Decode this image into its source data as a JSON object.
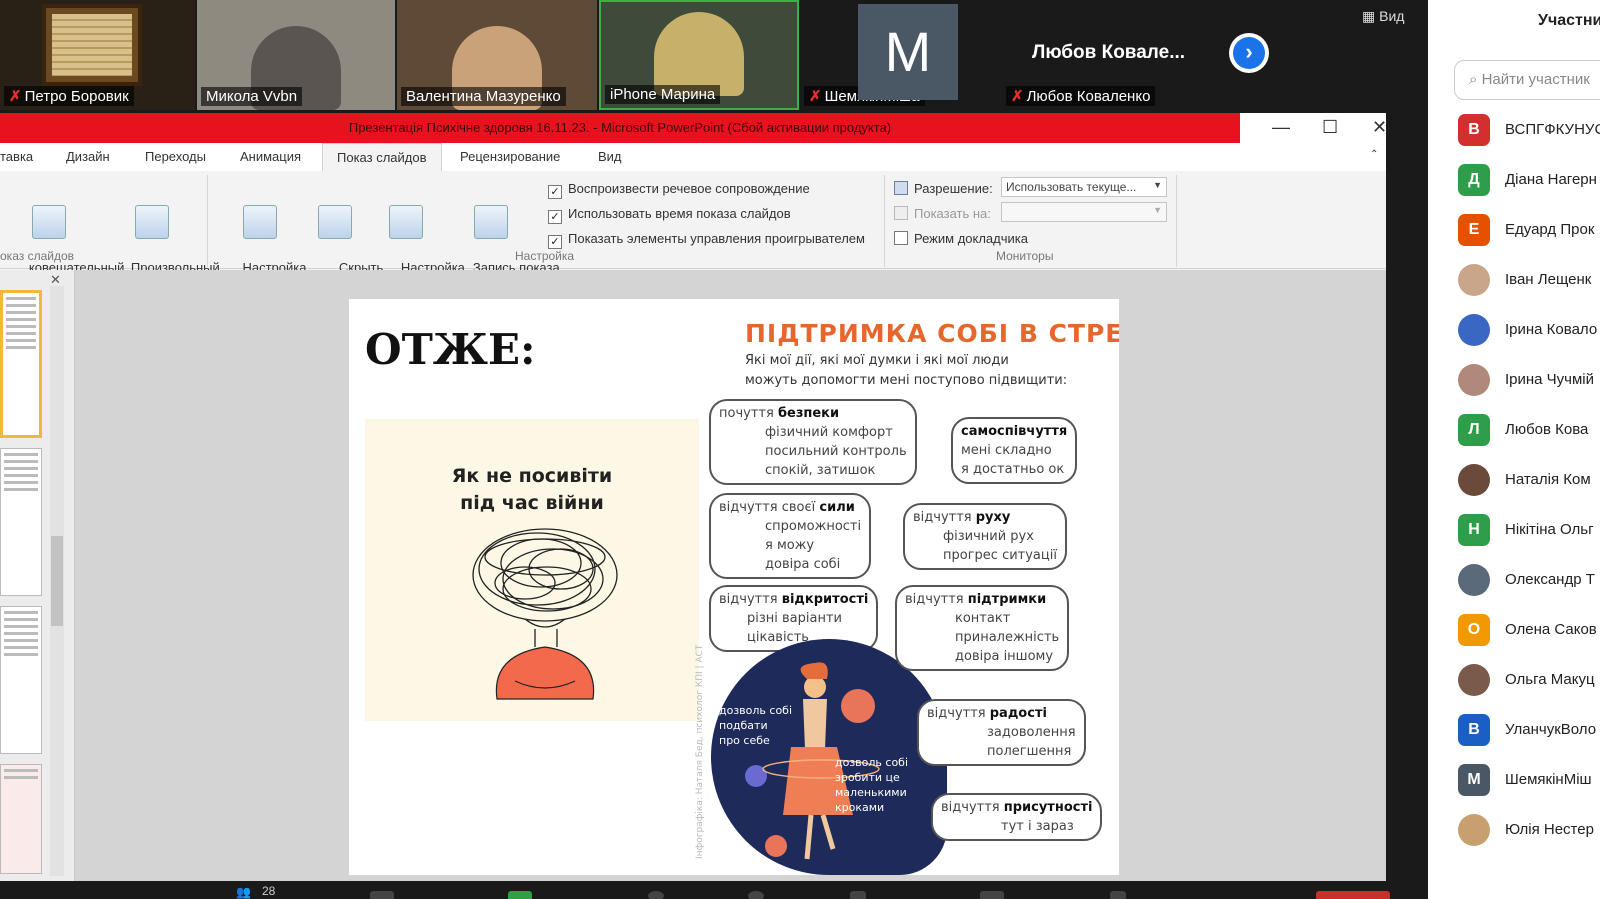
{
  "video_strip": {
    "tiles": [
      {
        "name": "Петро Боровик",
        "muted": true
      },
      {
        "name": "Микола Vvbn",
        "muted": false
      },
      {
        "name": "Валентина Мазуренко",
        "muted": false
      },
      {
        "name": "iPhone Марина",
        "muted": false
      },
      {
        "name": "ШемякінМіша",
        "muted": true,
        "avatar_letter": "M"
      },
      {
        "name": "Любов Коваленко",
        "muted": true,
        "big_name": "Любов Ковале..."
      }
    ],
    "view_label": "Вид",
    "next_icon": "chevron-right-icon"
  },
  "powerpoint": {
    "title": "Презентація Психічне здоровя 16.11.23. - Microsoft PowerPoint (Сбой активации продукта)",
    "title_color": "#e8111e",
    "tabs": [
      "тавка",
      "Дизайн",
      "Переходы",
      "Анимация",
      "Показ слайдов",
      "Рецензирование",
      "Вид"
    ],
    "active_tab": "Показ слайдов",
    "ribbon": {
      "btn_presenter": "ковещательный\nоказ слайдов",
      "btn_custom": "Произвольный\nпоказ ▾",
      "group_show": "оказ слайдов",
      "btn_setup": "Настройка\nдемонстрации",
      "btn_hide": "Скрыть\nслайд",
      "btn_timing": "Настройка\nвремени",
      "btn_record": "Запись показа\nслайдов ▾",
      "chk_narration": "Воспроизвести речевое сопровождение",
      "chk_timings": "Использовать время показа слайдов",
      "chk_controls": "Показать элементы управления проигрывателем",
      "group_setup": "Настройка",
      "resolution_label": "Разрешение:",
      "resolution_value": "Использовать текуще...",
      "show_on_label": "Показать на:",
      "presenter_mode": "Режим докладчика",
      "group_monitors": "Мониторы"
    }
  },
  "slide": {
    "title": "ОТЖЕ:",
    "book_title": "Як не посивіти\nпід час війни",
    "right_heading": "ПІДТРИМКА СОБІ В СТРЕСІ",
    "subtitle_line1": "Які мої дії, які мої думки і які мої люди",
    "subtitle_line2": "можуть допомогти мені поступово підвищити:",
    "clouds": [
      {
        "lead": "почуття ",
        "bold": "безпеки",
        "lines": [
          "фізичний комфорт",
          "посильний контроль",
          "спокій, затишок"
        ]
      },
      {
        "lead": "",
        "bold": "самоспівчуття",
        "lines": [
          "мені складно",
          "я достатньо ок"
        ]
      },
      {
        "lead": "відчуття своєї ",
        "bold": "сили",
        "lines": [
          "спроможності",
          "я можу",
          "довіра собі"
        ]
      },
      {
        "lead": "відчуття ",
        "bold": "руху",
        "lines": [
          "фізичний рух",
          "прогрес ситуації"
        ]
      },
      {
        "lead": "відчуття ",
        "bold": "відкритості",
        "lines": [
          "різні варіанти",
          "цікавість"
        ]
      },
      {
        "lead": "відчуття ",
        "bold": "підтримки",
        "lines": [
          "контакт",
          "приналежність",
          "довіра іншому"
        ]
      },
      {
        "lead": "відчуття ",
        "bold": "радості",
        "lines": [
          "задоволення",
          "полегшення"
        ]
      },
      {
        "lead": "відчуття ",
        "bold": "присутності",
        "lines": [
          "тут і зараз"
        ]
      }
    ],
    "annot_left": "дозволь собі\nподбати\nпро себе",
    "annot_right": "дозволь собі\nзробити це\nмаленькими\nкроками",
    "credit": "Інфографіка: Наталя Бед, психолог КПІ | АСТ"
  },
  "participants": {
    "title": "Участни",
    "search_placeholder": "Найти участник",
    "list": [
      {
        "initial": "В",
        "color": "#d32f2f",
        "name": "ВСПГФКУНУС"
      },
      {
        "initial": "Д",
        "color": "#2e9e4a",
        "name": "Діана Нагерн"
      },
      {
        "initial": "Е",
        "color": "#e65100",
        "name": "Едуард Прок"
      },
      {
        "initial": "",
        "color": "#c9a58a",
        "name": "Іван Лещенк"
      },
      {
        "initial": "",
        "color": "#3a66c4",
        "name": "Ірина Ковало"
      },
      {
        "initial": "",
        "color": "#b0897a",
        "name": "Ірина Чучмій"
      },
      {
        "initial": "Л",
        "color": "#2e9e4a",
        "name": "Любов Кова"
      },
      {
        "initial": "",
        "color": "#6b4a3a",
        "name": "Наталія Ком"
      },
      {
        "initial": "Н",
        "color": "#2e9e4a",
        "name": "Нікітіна Ольг"
      },
      {
        "initial": "",
        "color": "#5a6a7a",
        "name": "Олександр Т"
      },
      {
        "initial": "О",
        "color": "#f29900",
        "name": "Олена Саков"
      },
      {
        "initial": "",
        "color": "#7a5a4a",
        "name": "Ольга Макуц"
      },
      {
        "initial": "В",
        "color": "#1a5fc4",
        "name": "УланчукВоло"
      },
      {
        "initial": "М",
        "color": "#4a5866",
        "name": "ШемякінМіш"
      },
      {
        "initial": "",
        "color": "#c8a070",
        "name": "Юлія Нестер"
      }
    ]
  },
  "bottom_bar": {
    "participants_count": "28"
  }
}
